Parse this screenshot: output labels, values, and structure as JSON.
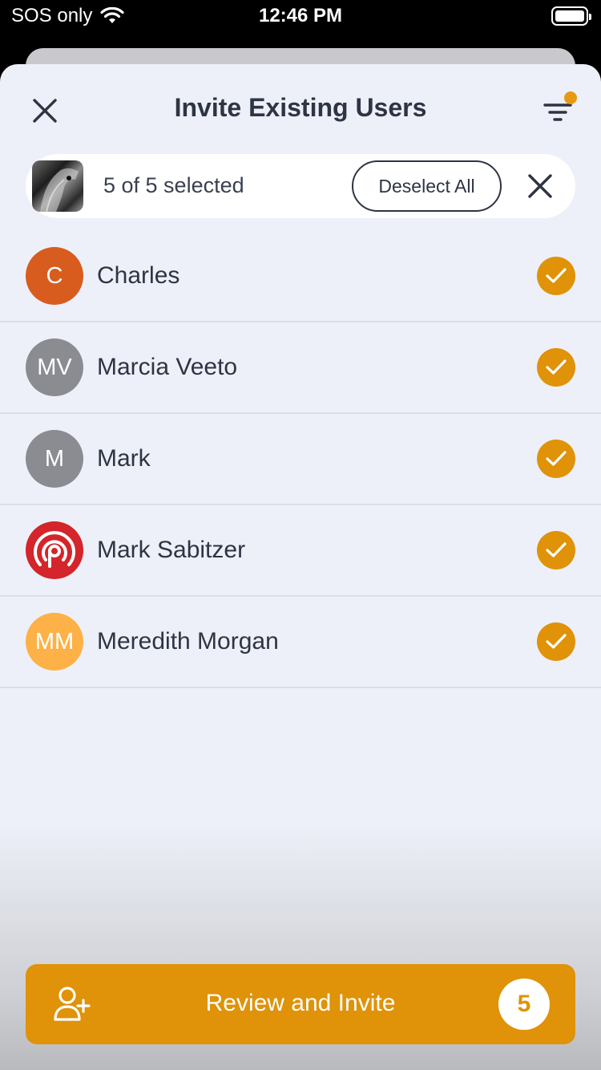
{
  "status_bar": {
    "carrier": "SOS only",
    "time": "12:46 PM"
  },
  "header": {
    "title": "Invite Existing Users"
  },
  "selection": {
    "count_text": "5 of 5 selected",
    "deselect_label": "Deselect All"
  },
  "users": [
    {
      "name": "Charles",
      "initials": "C",
      "avatar_color": "#d85c1e",
      "selected": true
    },
    {
      "name": "Marcia Veeto",
      "initials": "MV",
      "avatar_color": "#8a8c92",
      "selected": true
    },
    {
      "name": "Mark",
      "initials": "M",
      "avatar_color": "#8a8c92",
      "selected": true
    },
    {
      "name": "Mark Sabitzer",
      "initials": "",
      "avatar_icon": "p-signal-logo",
      "avatar_color": "#d3252b",
      "selected": true
    },
    {
      "name": "Meredith Morgan",
      "initials": "MM",
      "avatar_color": "#fdb146",
      "selected": true
    }
  ],
  "footer": {
    "button_label": "Review and Invite",
    "badge_count": "5"
  },
  "colors": {
    "accent": "#e09208",
    "sheet_background": "#edf0f8",
    "text_primary": "#2e3443"
  }
}
